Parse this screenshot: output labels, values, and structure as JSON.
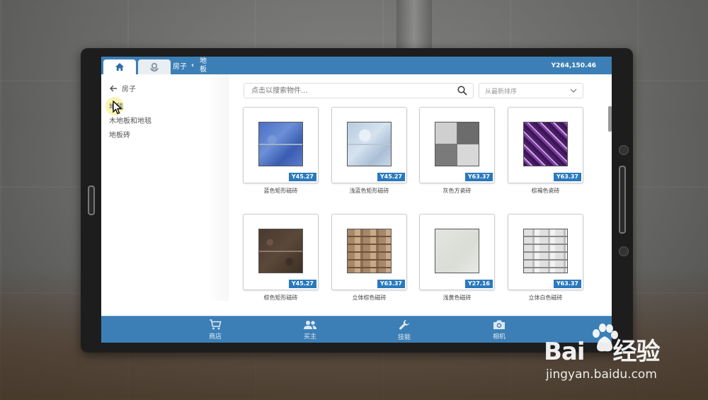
{
  "topbar": {
    "breadcrumb_parent": "房子",
    "breadcrumb_separator": "‹",
    "breadcrumb_current": "地板",
    "balance": "Y264,150.46",
    "tabs": [
      {
        "icon": "home-icon"
      },
      {
        "icon": "plant-icon"
      }
    ]
  },
  "sidebar": {
    "back_label": "房子",
    "categories": [
      "地毯",
      "木地板和地毯",
      "地板砖"
    ]
  },
  "search": {
    "placeholder": "点击以搜索物件...",
    "sort_selected": "从最新排序"
  },
  "products": [
    {
      "name": "蓝色矩形磁砖",
      "price": "Y45.27",
      "texture": "blue"
    },
    {
      "name": "浅蓝色矩形磁砖",
      "price": "Y45.27",
      "texture": "lightblue"
    },
    {
      "name": "灰色方瓷砖",
      "price": "Y63.37",
      "texture": "gray"
    },
    {
      "name": "棕褐色瓷砖",
      "price": "Y63.37",
      "texture": "purple"
    },
    {
      "name": "棕色矩形磁砖",
      "price": "Y45.27",
      "texture": "brown"
    },
    {
      "name": "立体棕色磁砖",
      "price": "Y63.37",
      "texture": "stone"
    },
    {
      "name": "浅黄色磁砖",
      "price": "Y27.16",
      "texture": "beige"
    },
    {
      "name": "立体白色磁砖",
      "price": "Y63.37",
      "texture": "white"
    }
  ],
  "bottombar": {
    "items": [
      {
        "label": "商店",
        "icon": "cart-icon"
      },
      {
        "label": "买主",
        "icon": "people-icon"
      },
      {
        "label": "技能",
        "icon": "wrench-icon"
      },
      {
        "label": "相机",
        "icon": "camera-icon"
      }
    ]
  },
  "watermark": {
    "brand": "Bai",
    "brand_suffix": "经验",
    "url": "jingyan.baidu.com"
  },
  "colors": {
    "bar_blue": "#3c7fb6",
    "price_blue": "#2a79bd"
  }
}
